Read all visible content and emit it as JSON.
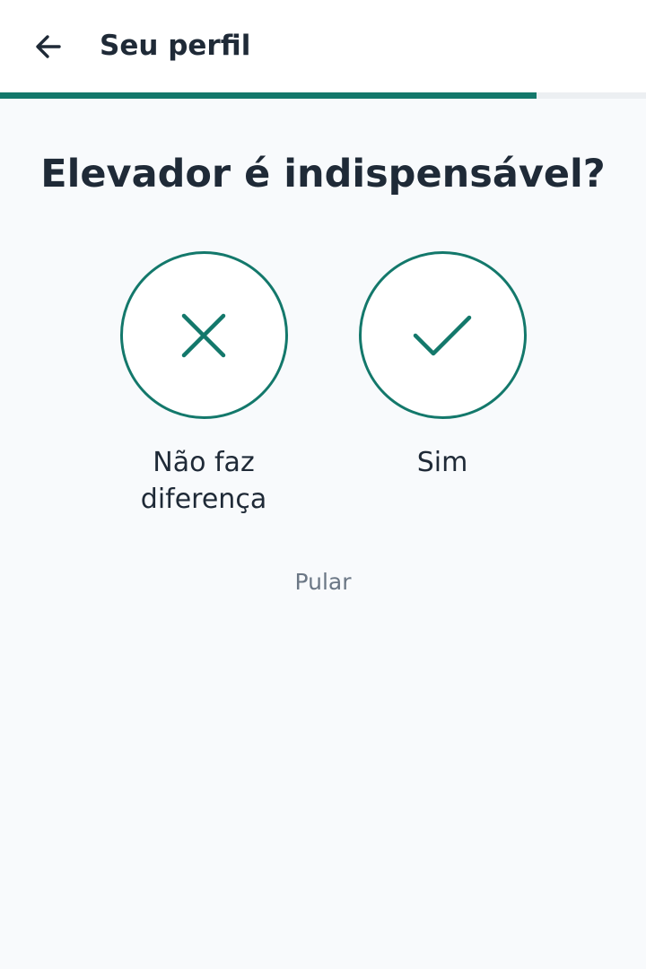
{
  "header": {
    "back_icon": "arrow-left-icon",
    "title": "Seu perfil"
  },
  "progress": {
    "fraction": 0.83,
    "fill_color": "#13786b",
    "track_color": "#eceff2"
  },
  "question": "Elevador é indispensável?",
  "options": [
    {
      "label": "Não faz diferença",
      "icon": "close-icon"
    },
    {
      "label": "Sim",
      "icon": "check-icon"
    }
  ],
  "skip_label": "Pular",
  "colors": {
    "accent": "#13786b",
    "background": "#f8fafc",
    "text": "#1f2a37",
    "muted": "#6b7785"
  }
}
